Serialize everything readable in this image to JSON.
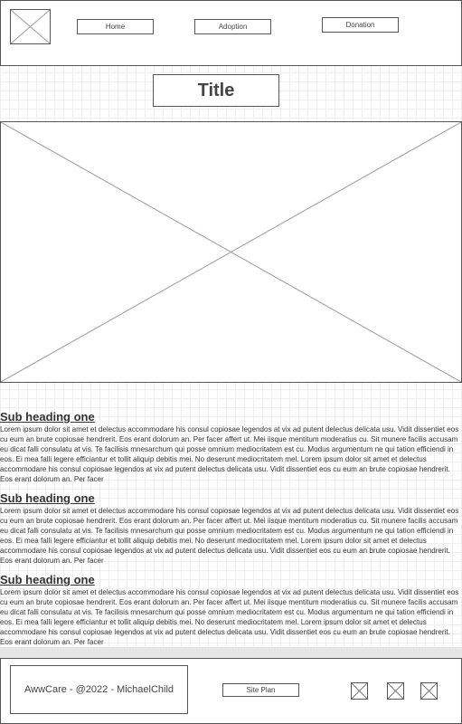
{
  "header": {
    "logo_icon": "image-placeholder-icon",
    "nav": [
      {
        "label": "Home"
      },
      {
        "label": "Adoption"
      },
      {
        "label": "Donation"
      }
    ]
  },
  "title": "Title",
  "hero": {
    "icon": "image-placeholder-icon"
  },
  "sections": [
    {
      "heading": "Sub heading one",
      "body": "Lorem ipsum dolor sit amet et delectus accommodare his consul copiosae legendos at vix ad putent delectus delicata usu. Vidit dissentiet eos cu eum an brute copiosae hendrerit. Eos erant dolorum an. Per facer affert ut. Mei iisque mentitum moderatius cu. Sit munere facilis accusam eu dicat falli consulatu at vis. Te facilisis mnesarchum qui posse omnium mediocritatem est cu. Modus argumentum ne qui tation efficiendi in eos. Ei mea falli legere efficiantur et tollit aliquip debitis mei. No deserunt mediocritatem mel. Lorem ipsum dolor sit amet et delectus accommodare his consul copiosae legendos at vix ad putent delectus delicata usu. Vidit dissentiet eos cu eum an brute copiosae hendrerit. Eos erant dolorum an. Per facer"
    },
    {
      "heading": "Sub heading one",
      "body": "Lorem ipsum dolor sit amet et delectus accommodare his consul copiosae legendos at vix ad putent delectus delicata usu. Vidit dissentiet eos cu eum an brute copiosae hendrerit. Eos erant dolorum an. Per facer affert ut. Mei iisque mentitum moderatius cu. Sit munere facilis accusam eu dicat falli consulatu at vis. Te facilisis mnesarchum qui posse omnium mediocritatem est cu. Modus argumentum ne qui tation efficiendi in eos. Ei mea falli legere efficiantur et tollit aliquip debitis mei. No deserunt mediocritatem mel. Lorem ipsum dolor sit amet et delectus accommodare his consul copiosae legendos at vix ad putent delectus delicata usu. Vidit dissentiet eos cu eum an brute copiosae hendrerit. Eos erant dolorum an. Per facer"
    },
    {
      "heading": "Sub heading one",
      "body": "Lorem ipsum dolor sit amet et delectus accommodare his consul copiosae legendos at vix ad putent delectus delicata usu. Vidit dissentiet eos cu eum an brute copiosae hendrerit. Eos erant dolorum an. Per facer affert ut. Mei iisque mentitum moderatius cu. Sit munere facilis accusam eu dicat falli consulatu at vis. Te facilisis mnesarchum qui posse omnium mediocritatem est cu. Modus argumentum ne qui tation efficiendi in eos. Ei mea falli legere efficiantur et tollit aliquip debitis mei. No deserunt mediocritatem mel. Lorem ipsum dolor sit amet et delectus accommodare his consul copiosae legendos at vix ad putent delectus delicata usu. Vidit dissentiet eos cu eum an brute copiosae hendrerit. Eos erant dolorum an. Per facer"
    }
  ],
  "footer": {
    "credit": "AwwCare - @2022 - MichaelChild",
    "site_plan_label": "Site Plan",
    "social_icons": [
      "image-placeholder-icon",
      "image-placeholder-icon",
      "image-placeholder-icon"
    ]
  },
  "colors": {
    "border": "#555555",
    "grid": "#efefef",
    "placeholder_line": "#999999",
    "footer_band": "#e6e6e6"
  }
}
